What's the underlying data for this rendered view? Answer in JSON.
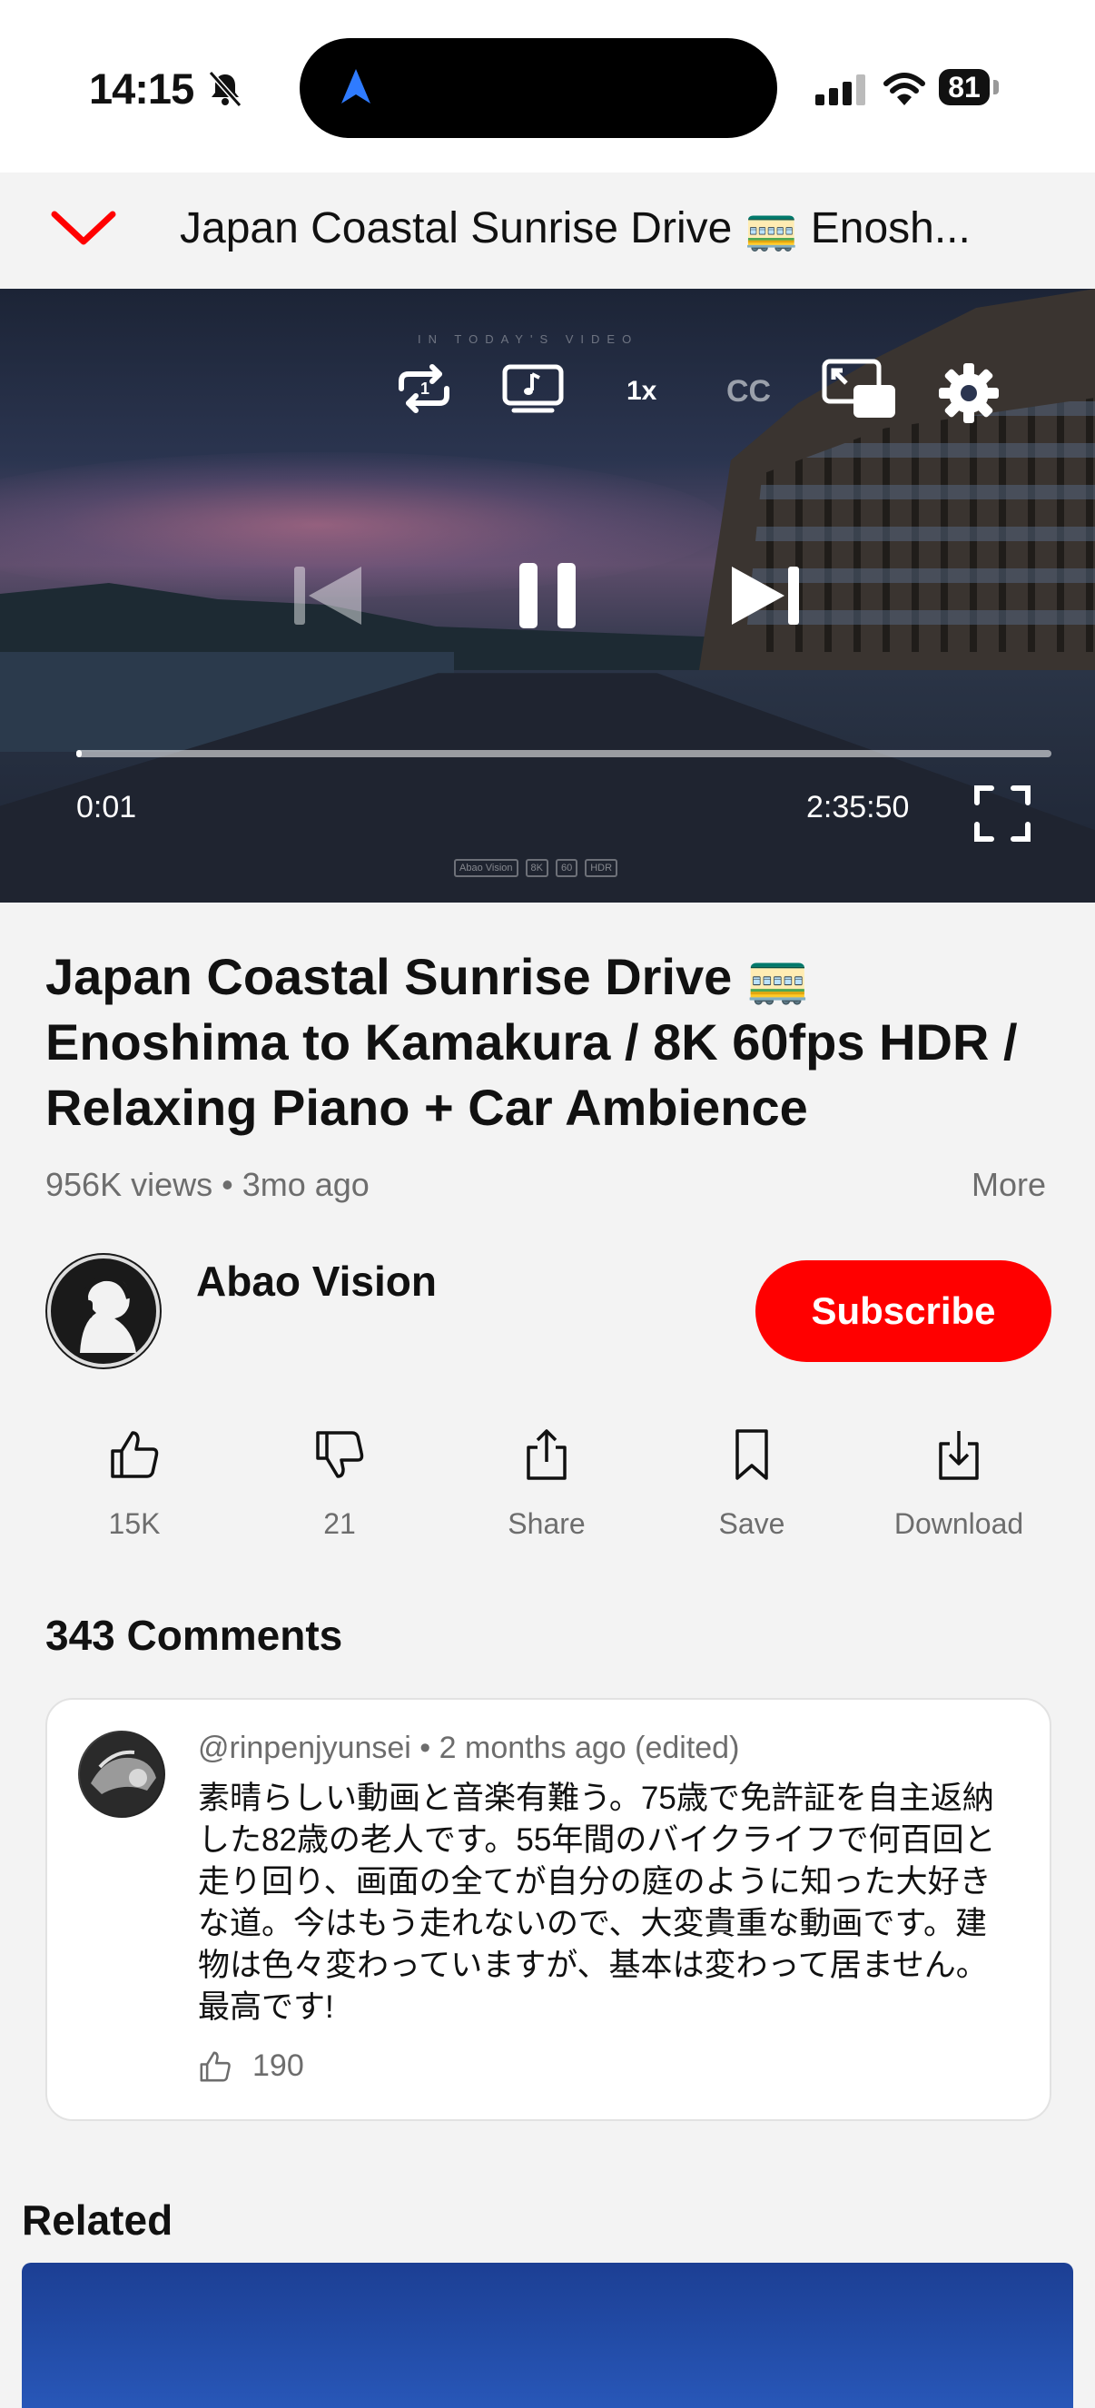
{
  "status_bar": {
    "time": "14:15",
    "battery": "81"
  },
  "header": {
    "title": "Japan Coastal Sunrise Drive 🚃 Enosh..."
  },
  "player": {
    "speed_label": "1x",
    "cc_label": "CC",
    "current_time": "0:01",
    "duration": "2:35:50",
    "progress": 0.0001,
    "watermark": [
      "Abao Vision",
      "8K",
      "60",
      "HDR"
    ],
    "intro_text": "IN TODAY'S VIDEO"
  },
  "video": {
    "title": "Japan Coastal Sunrise Drive 🚃 Enoshima to Kamakura / 8K 60fps HDR / Relaxing Piano + Car Ambience",
    "meta": "956K views • 3mo ago",
    "more_label": "More"
  },
  "channel": {
    "name": "Abao Vision",
    "subscribe_label": "Subscribe"
  },
  "actions": {
    "like": "15K",
    "dislike": "21",
    "share": "Share",
    "save": "Save",
    "download": "Download"
  },
  "comments": {
    "header": "343 Comments",
    "top": {
      "author_meta": "@rinpenjyunsei • 2 months ago (edited)",
      "text": "素晴らしい動画と音楽有難う。75歳で免許証を自主返納した82歳の老人です。55年間のバイクライフで何百回と走り回り、画面の全てが自分の庭のように知った大好きな道。今はもう走れないので、大変貴重な動画です。建物は色々変わっていますが、基本は変わって居ません。最高です!",
      "likes": "190"
    }
  },
  "related": {
    "header": "Related"
  },
  "colors": {
    "accent": "#ff0000",
    "text": "#111111",
    "muted": "#6d6d6d",
    "background": "#f3f3f3"
  }
}
